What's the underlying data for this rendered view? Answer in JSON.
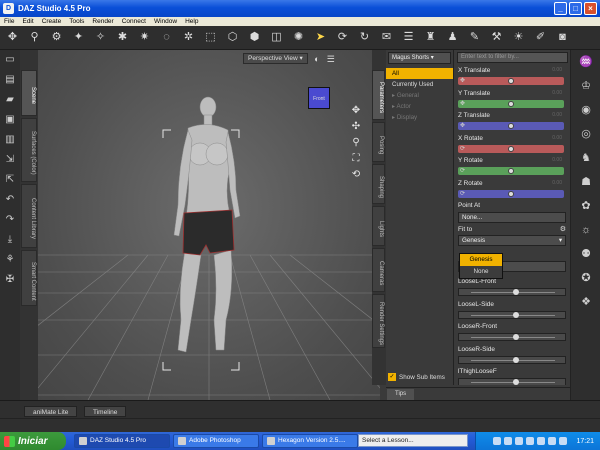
{
  "window": {
    "title": "DAZ Studio 4.5 Pro",
    "controls": [
      "minimize",
      "maximize",
      "close"
    ]
  },
  "menu": [
    "File",
    "Edit",
    "Create",
    "Tools",
    "Render",
    "Connect",
    "Window",
    "Help"
  ],
  "left_tabs": [
    "Scene",
    "Surfaces (Color)",
    "Content Library",
    "Smart Content"
  ],
  "viewport": {
    "camera": "Perspective View",
    "view_cube_label": "Front"
  },
  "param_tabs": [
    "Parameters",
    "Posing",
    "Shaping",
    "Lights",
    "Cameras",
    "Render Settings"
  ],
  "node_selector": "Magus Shorts",
  "groups": [
    {
      "label": "All",
      "selected": true
    },
    {
      "label": "Currently Used",
      "selected": false
    },
    {
      "label": "▸ General",
      "selected": false
    },
    {
      "label": "▸ Actor",
      "selected": false
    },
    {
      "label": "▸ Display",
      "selected": false
    }
  ],
  "show_sub_items": "Show Sub Items",
  "filter_placeholder": "Enter text to filter by...",
  "transform_params": [
    {
      "label": "X Translate",
      "value": "0.00",
      "color": "#b95a5a"
    },
    {
      "label": "Y Translate",
      "value": "0.00",
      "color": "#5aa05a"
    },
    {
      "label": "Z Translate",
      "value": "0.00",
      "color": "#5a5ab5"
    },
    {
      "label": "X Rotate",
      "value": "0.00",
      "color": "#b95a5a"
    },
    {
      "label": "Y Rotate",
      "value": "0.00",
      "color": "#5aa05a"
    },
    {
      "label": "Z Rotate",
      "value": "0.00",
      "color": "#5a5ab5"
    }
  ],
  "point_at": {
    "label": "Point At",
    "value": "None..."
  },
  "fit_to": {
    "label": "Fit to",
    "value": "Genesis"
  },
  "fit_popup": [
    {
      "label": "Genesis",
      "selected": true
    },
    {
      "label": "None",
      "selected": false
    }
  ],
  "morph_params": [
    "LooseL-Front",
    "LooseL-Side",
    "LooseR-Front",
    "LooseR-Side",
    "lThighLooseF"
  ],
  "tips_tab": "Tips",
  "bottom_tabs": [
    "aniMate Lite",
    "Timeline"
  ],
  "taskbar": {
    "start": "Iniciar",
    "tasks": [
      "DAZ Studio 4.5 Pro",
      "Adobe Photoshop",
      "Hexagon Version 2.5...."
    ],
    "lesson_placeholder": "Select a Lesson...",
    "clock": "17:21"
  }
}
